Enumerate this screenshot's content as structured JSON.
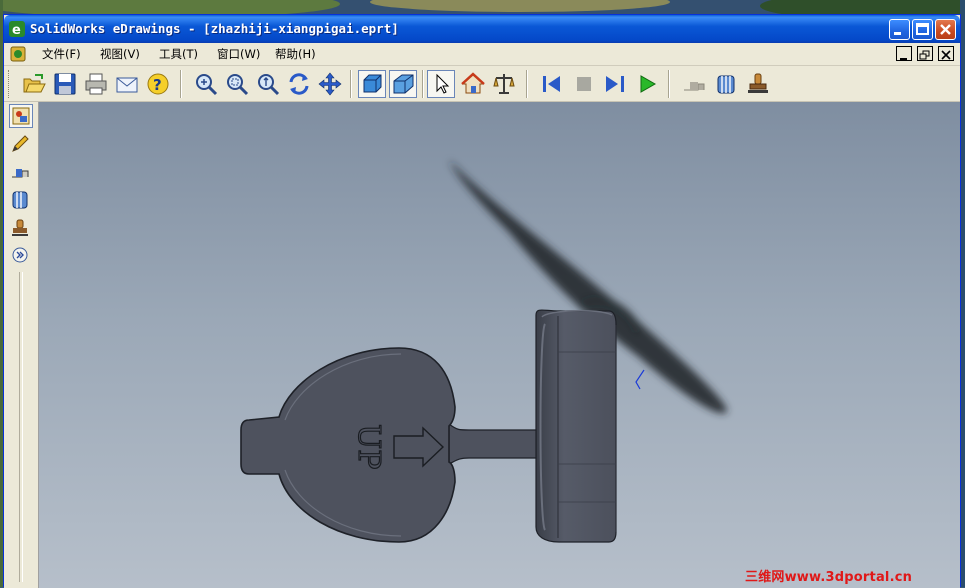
{
  "window": {
    "title": "SolidWorks eDrawings - [zhazhiji-xiangpigai.eprt]",
    "accent": "#0a58d6"
  },
  "menu": {
    "items": [
      {
        "label": "文件(F)"
      },
      {
        "label": "视图(V)"
      },
      {
        "label": "工具(T)"
      },
      {
        "label": "窗口(W)"
      },
      {
        "label": "帮助(H)"
      }
    ]
  },
  "toolbar": {
    "buttons": [
      "open-icon",
      "save-icon",
      "print-icon",
      "email-icon",
      "help-icon",
      "zoom-to-fit-icon",
      "zoom-to-area-icon",
      "zoom-in-out-icon",
      "rotate-icon",
      "pan-icon",
      "shaded-icon",
      "perspective-icon",
      "select-icon",
      "home-icon",
      "measure-icon",
      "first-frame-icon",
      "stop-icon",
      "next-frame-icon",
      "play-icon",
      "move-component-icon",
      "section-icon",
      "stamp-icon"
    ]
  },
  "sidepanel": {
    "buttons": [
      "components-icon",
      "markup-icon",
      "move-icon",
      "cross-section-icon",
      "stamp-icon",
      "expand-icon"
    ]
  },
  "model": {
    "engraving": "UP"
  },
  "watermark": "三维网www.3dportal.cn"
}
